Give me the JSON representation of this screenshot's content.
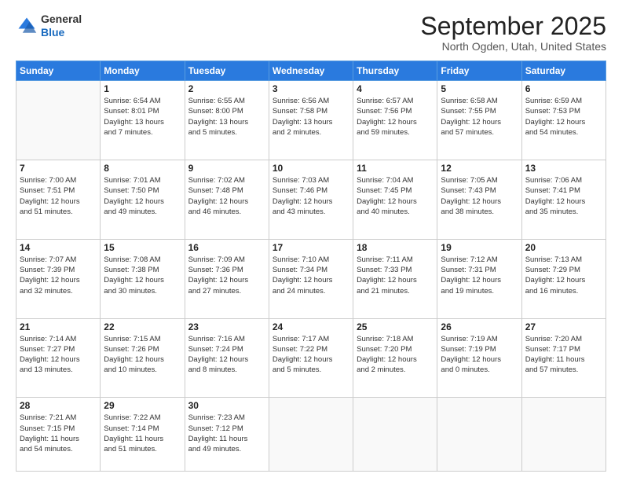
{
  "header": {
    "logo_general": "General",
    "logo_blue": "Blue",
    "month_title": "September 2025",
    "location": "North Ogden, Utah, United States"
  },
  "days_of_week": [
    "Sunday",
    "Monday",
    "Tuesday",
    "Wednesday",
    "Thursday",
    "Friday",
    "Saturday"
  ],
  "weeks": [
    [
      {
        "day": "",
        "info": ""
      },
      {
        "day": "1",
        "info": "Sunrise: 6:54 AM\nSunset: 8:01 PM\nDaylight: 13 hours\nand 7 minutes."
      },
      {
        "day": "2",
        "info": "Sunrise: 6:55 AM\nSunset: 8:00 PM\nDaylight: 13 hours\nand 5 minutes."
      },
      {
        "day": "3",
        "info": "Sunrise: 6:56 AM\nSunset: 7:58 PM\nDaylight: 13 hours\nand 2 minutes."
      },
      {
        "day": "4",
        "info": "Sunrise: 6:57 AM\nSunset: 7:56 PM\nDaylight: 12 hours\nand 59 minutes."
      },
      {
        "day": "5",
        "info": "Sunrise: 6:58 AM\nSunset: 7:55 PM\nDaylight: 12 hours\nand 57 minutes."
      },
      {
        "day": "6",
        "info": "Sunrise: 6:59 AM\nSunset: 7:53 PM\nDaylight: 12 hours\nand 54 minutes."
      }
    ],
    [
      {
        "day": "7",
        "info": "Sunrise: 7:00 AM\nSunset: 7:51 PM\nDaylight: 12 hours\nand 51 minutes."
      },
      {
        "day": "8",
        "info": "Sunrise: 7:01 AM\nSunset: 7:50 PM\nDaylight: 12 hours\nand 49 minutes."
      },
      {
        "day": "9",
        "info": "Sunrise: 7:02 AM\nSunset: 7:48 PM\nDaylight: 12 hours\nand 46 minutes."
      },
      {
        "day": "10",
        "info": "Sunrise: 7:03 AM\nSunset: 7:46 PM\nDaylight: 12 hours\nand 43 minutes."
      },
      {
        "day": "11",
        "info": "Sunrise: 7:04 AM\nSunset: 7:45 PM\nDaylight: 12 hours\nand 40 minutes."
      },
      {
        "day": "12",
        "info": "Sunrise: 7:05 AM\nSunset: 7:43 PM\nDaylight: 12 hours\nand 38 minutes."
      },
      {
        "day": "13",
        "info": "Sunrise: 7:06 AM\nSunset: 7:41 PM\nDaylight: 12 hours\nand 35 minutes."
      }
    ],
    [
      {
        "day": "14",
        "info": "Sunrise: 7:07 AM\nSunset: 7:39 PM\nDaylight: 12 hours\nand 32 minutes."
      },
      {
        "day": "15",
        "info": "Sunrise: 7:08 AM\nSunset: 7:38 PM\nDaylight: 12 hours\nand 30 minutes."
      },
      {
        "day": "16",
        "info": "Sunrise: 7:09 AM\nSunset: 7:36 PM\nDaylight: 12 hours\nand 27 minutes."
      },
      {
        "day": "17",
        "info": "Sunrise: 7:10 AM\nSunset: 7:34 PM\nDaylight: 12 hours\nand 24 minutes."
      },
      {
        "day": "18",
        "info": "Sunrise: 7:11 AM\nSunset: 7:33 PM\nDaylight: 12 hours\nand 21 minutes."
      },
      {
        "day": "19",
        "info": "Sunrise: 7:12 AM\nSunset: 7:31 PM\nDaylight: 12 hours\nand 19 minutes."
      },
      {
        "day": "20",
        "info": "Sunrise: 7:13 AM\nSunset: 7:29 PM\nDaylight: 12 hours\nand 16 minutes."
      }
    ],
    [
      {
        "day": "21",
        "info": "Sunrise: 7:14 AM\nSunset: 7:27 PM\nDaylight: 12 hours\nand 13 minutes."
      },
      {
        "day": "22",
        "info": "Sunrise: 7:15 AM\nSunset: 7:26 PM\nDaylight: 12 hours\nand 10 minutes."
      },
      {
        "day": "23",
        "info": "Sunrise: 7:16 AM\nSunset: 7:24 PM\nDaylight: 12 hours\nand 8 minutes."
      },
      {
        "day": "24",
        "info": "Sunrise: 7:17 AM\nSunset: 7:22 PM\nDaylight: 12 hours\nand 5 minutes."
      },
      {
        "day": "25",
        "info": "Sunrise: 7:18 AM\nSunset: 7:20 PM\nDaylight: 12 hours\nand 2 minutes."
      },
      {
        "day": "26",
        "info": "Sunrise: 7:19 AM\nSunset: 7:19 PM\nDaylight: 12 hours\nand 0 minutes."
      },
      {
        "day": "27",
        "info": "Sunrise: 7:20 AM\nSunset: 7:17 PM\nDaylight: 11 hours\nand 57 minutes."
      }
    ],
    [
      {
        "day": "28",
        "info": "Sunrise: 7:21 AM\nSunset: 7:15 PM\nDaylight: 11 hours\nand 54 minutes."
      },
      {
        "day": "29",
        "info": "Sunrise: 7:22 AM\nSunset: 7:14 PM\nDaylight: 11 hours\nand 51 minutes."
      },
      {
        "day": "30",
        "info": "Sunrise: 7:23 AM\nSunset: 7:12 PM\nDaylight: 11 hours\nand 49 minutes."
      },
      {
        "day": "",
        "info": ""
      },
      {
        "day": "",
        "info": ""
      },
      {
        "day": "",
        "info": ""
      },
      {
        "day": "",
        "info": ""
      }
    ]
  ]
}
